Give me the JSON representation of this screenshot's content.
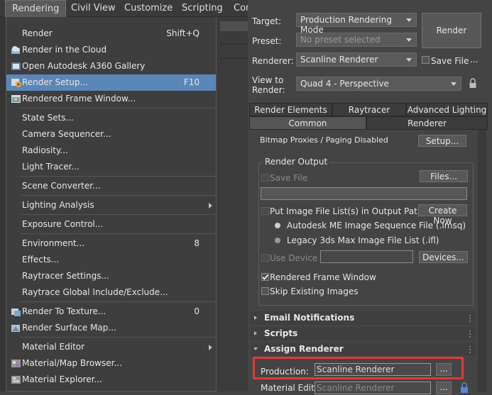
{
  "menubar": {
    "items": [
      {
        "label": "Rendering",
        "active": true
      },
      {
        "label": "Civil View"
      },
      {
        "label": "Customize"
      },
      {
        "label": "Scripting"
      },
      {
        "label": "Con"
      }
    ]
  },
  "rendering_menu": {
    "items": [
      {
        "label": "Render",
        "shortcut": "Shift+Q",
        "icon": "none"
      },
      {
        "label": "Render in the Cloud",
        "icon": "cloud-render-icon"
      },
      {
        "label": "Open Autodesk A360 Gallery",
        "icon": "gallery-icon"
      },
      {
        "label": "Render Setup...",
        "shortcut": "F10",
        "icon": "render-setup-icon",
        "highlighted": true
      },
      {
        "label": "Rendered Frame Window...",
        "icon": "frame-window-icon"
      },
      {
        "label": "State Sets..."
      },
      {
        "label": "Camera Sequencer..."
      },
      {
        "label": "Radiosity..."
      },
      {
        "label": "Light Tracer..."
      },
      {
        "label": "Scene Converter..."
      },
      {
        "label": "Lighting Analysis",
        "submenu": true
      },
      {
        "label": "Exposure Control..."
      },
      {
        "label": "Environment...",
        "shortcut": "8"
      },
      {
        "label": "Effects..."
      },
      {
        "label": "Raytracer Settings..."
      },
      {
        "label": "Raytrace Global Include/Exclude..."
      },
      {
        "label": "Render To Texture...",
        "shortcut": "0",
        "icon": "render-to-texture-icon"
      },
      {
        "label": "Render Surface Map...",
        "icon": "surface-map-icon"
      },
      {
        "label": "Material Editor",
        "submenu": true
      },
      {
        "label": "Material/Map Browser...",
        "icon": "material-browser-icon"
      },
      {
        "label": "Material Explorer...",
        "icon": "material-explorer-icon"
      }
    ]
  },
  "render_setup": {
    "target_label": "Target:",
    "target_value": "Production Rendering Mode",
    "preset_label": "Preset:",
    "preset_value": "No preset selected",
    "renderer_label": "Renderer:",
    "renderer_value": "Scanline Renderer",
    "save_file_label": "Save File",
    "more_label": "...",
    "view_label_1": "View to",
    "view_label_2": "Render:",
    "view_value": "Quad 4 - Perspective",
    "render_button": "Render",
    "tabs_row1": [
      "Render Elements",
      "Raytracer",
      "Advanced Lighting"
    ],
    "tabs_row2": [
      "Common",
      "Renderer"
    ],
    "selected_tab": "Common",
    "bitmap_proxies_text": "Bitmap Proxies / Paging Disabled",
    "setup_button": "Setup...",
    "render_output": {
      "group_label": "Render Output",
      "save_file": "Save File",
      "files_button": "Files...",
      "put_image_list": "Put Image File List(s) in Output Path(s)",
      "create_now_button": "Create Now",
      "option_imsq": "Autodesk ME Image Sequence File (.imsq)",
      "option_ifl": "Legacy 3ds Max Image File List (.ifl)",
      "use_device": "Use Device",
      "devices_button": "Devices...",
      "rendered_frame_window": "Rendered Frame Window",
      "skip_existing": "Skip Existing Images"
    },
    "rollouts": [
      {
        "label": "Email Notifications",
        "open": false
      },
      {
        "label": "Scripts",
        "open": false
      },
      {
        "label": "Assign Renderer",
        "open": true
      }
    ],
    "assign_renderer": {
      "production_label": "Production:",
      "production_value": "Scanline Renderer",
      "material_editor_label": "Material Editor:",
      "material_editor_value": "Scanline Renderer",
      "browse_button": "..."
    },
    "highlight_color": "#e03a3a"
  }
}
